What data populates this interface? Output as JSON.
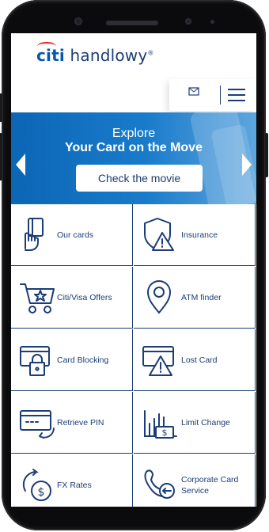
{
  "app": {
    "logo_prefix": "citi",
    "logo_suffix": " handlowy",
    "logo_reg": "®"
  },
  "banner": {
    "line1": "Explore",
    "line2": "Your Card on the Move",
    "cta_label": "Check the movie"
  },
  "tiles": [
    {
      "label": "Our cards",
      "icon": "card-hand-icon"
    },
    {
      "label": "Insurance",
      "icon": "shield-warning-icon"
    },
    {
      "label": "Citi/Visa Offers",
      "icon": "cart-star-icon"
    },
    {
      "label": "ATM finder",
      "icon": "location-pin-icon"
    },
    {
      "label": "Card Blocking",
      "icon": "card-lock-icon"
    },
    {
      "label": "Lost Card",
      "icon": "card-warning-icon"
    },
    {
      "label": "Retrieve PIN",
      "icon": "card-refresh-icon"
    },
    {
      "label": "Limit Change",
      "icon": "bars-dollar-icon"
    },
    {
      "label": "FX Rates",
      "icon": "dollar-exchange-icon"
    },
    {
      "label": "Corporate Card Service",
      "icon": "phone-card-icon"
    }
  ],
  "colors": {
    "brand_navy": "#1b3d77",
    "brand_blue": "#0a56a8",
    "brand_red": "#e1261c",
    "banner_blue": "#0b66b5"
  }
}
